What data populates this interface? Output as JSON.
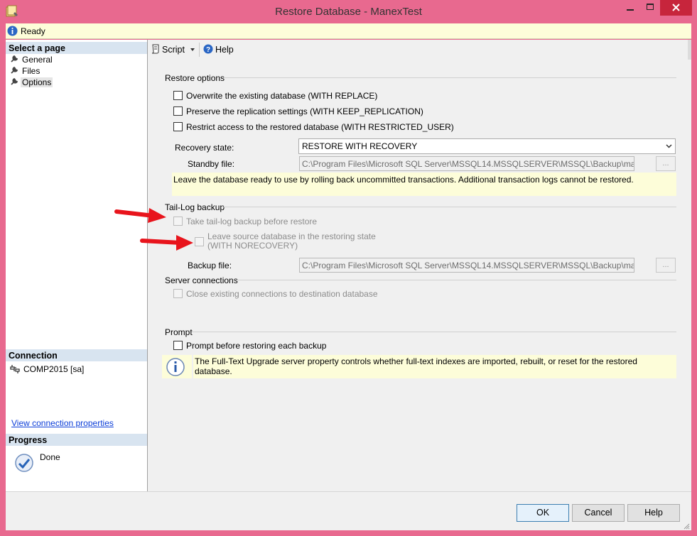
{
  "window": {
    "title": "Restore Database - ManexTest",
    "minimize_glyph": "—",
    "maximize_glyph": "□",
    "close_glyph": "✕"
  },
  "status": {
    "text": "Ready",
    "icon": "info-icon"
  },
  "left": {
    "select_page_header": "Select a page",
    "pages": [
      {
        "label": "General",
        "icon": "wrench-icon"
      },
      {
        "label": "Files",
        "icon": "wrench-icon"
      },
      {
        "label": "Options",
        "icon": "wrench-icon",
        "selected": true
      }
    ],
    "connection_header": "Connection",
    "connection_value": "COMP2015 [sa]",
    "view_connection_link": "View connection properties",
    "progress_header": "Progress",
    "progress_value": "Done"
  },
  "toolbar": {
    "script_label": "Script",
    "help_label": "Help"
  },
  "restore_options": {
    "header": "Restore options",
    "overwrite": "Overwrite the existing database (WITH REPLACE)",
    "preserve": "Preserve the replication settings (WITH KEEP_REPLICATION)",
    "restrict": "Restrict access to the restored database (WITH RESTRICTED_USER)",
    "recovery_state_label": "Recovery state:",
    "recovery_state_value": "RESTORE WITH RECOVERY",
    "standby_label": "Standby file:",
    "standby_value": "C:\\Program Files\\Microsoft SQL Server\\MSSQL14.MSSQLSERVER\\MSSQL\\Backup\\manexfc_R",
    "browse_label": "...",
    "recovery_note": "Leave the database ready to use by rolling back uncommitted transactions. Additional transaction logs cannot be restored."
  },
  "tail_log": {
    "header": "Tail-Log backup",
    "take_tail": "Take tail-log backup before restore",
    "leave_source_line1": "Leave source database in the restoring state",
    "leave_source_line2": "(WITH NORECOVERY)",
    "backup_file_label": "Backup file:",
    "backup_file_value": "C:\\Program Files\\Microsoft SQL Server\\MSSQL14.MSSQLSERVER\\MSSQL\\Backup\\manexfc_Lo",
    "browse_label": "..."
  },
  "server_connections": {
    "header": "Server connections",
    "close_existing": "Close existing connections to destination database"
  },
  "prompt": {
    "header": "Prompt",
    "prompt_before": "Prompt before restoring each backup",
    "info_note": "The Full-Text Upgrade server property controls whether full-text indexes are imported, rebuilt, or reset for the restored database."
  },
  "buttons": {
    "ok": "OK",
    "cancel": "Cancel",
    "help": "Help"
  },
  "colors": {
    "arrow": "#e8141c",
    "title_bar": "#e8698f",
    "close_button": "#c7253c",
    "note_background": "#fdfdd9"
  }
}
